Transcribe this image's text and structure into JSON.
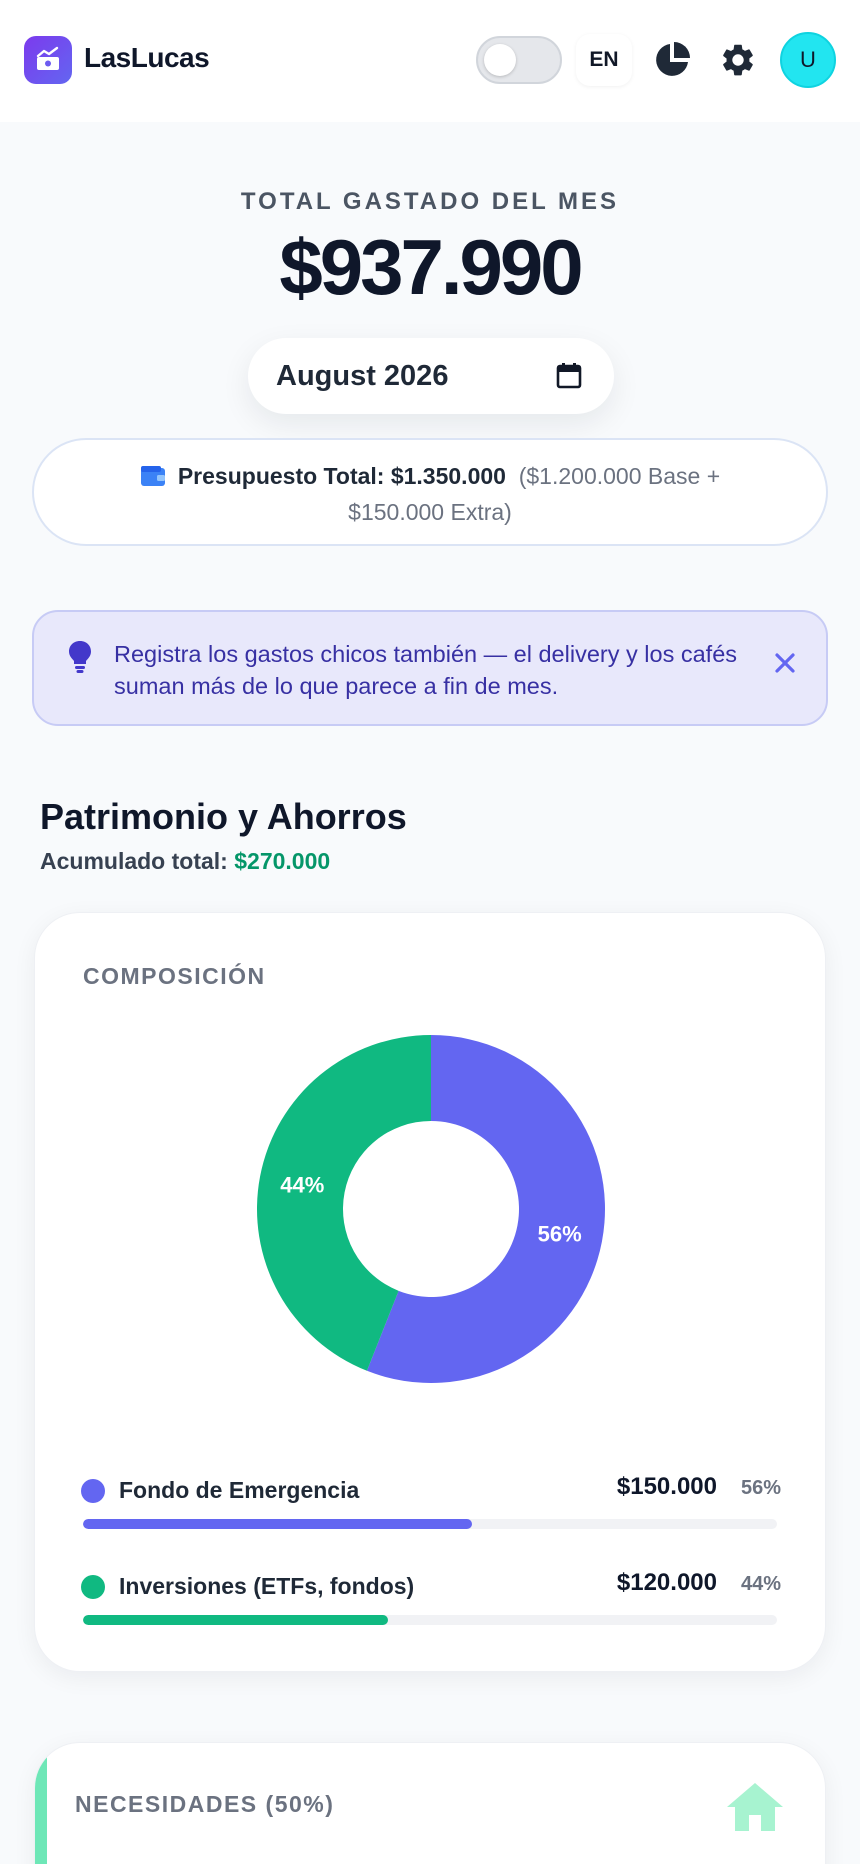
{
  "header": {
    "app_name": "LasLucas",
    "language": "EN",
    "avatar_initial": "U",
    "icons": [
      "logo-chart-icon",
      "pie-chart-icon",
      "gear-icon"
    ]
  },
  "summary": {
    "total_label": "TOTAL GASTADO DEL MES",
    "total_amount": "$937.990",
    "month": "August 2026"
  },
  "budget": {
    "label": "Presupuesto Total: $1.350.000",
    "detail": "($1.200.000 Base + $150.000 Extra)"
  },
  "tip": {
    "text": "Registra los gastos chicos también — el delivery y los cafés suman más de lo que parece a fin de mes."
  },
  "patrimonio": {
    "title": "Patrimonio y Ahorros",
    "subtitle_label": "Acumulado total:",
    "subtitle_amount": "$270.000",
    "card_label": "COMPOSICIÓN",
    "items": [
      {
        "name": "Fondo de Emergencia",
        "amount": "$150.000",
        "pct": "56%",
        "fraction": 0.56,
        "color": "#6366f1"
      },
      {
        "name": "Inversiones (ETFs, fondos)",
        "amount": "$120.000",
        "pct": "44%",
        "fraction": 0.44,
        "color": "#10b981"
      }
    ]
  },
  "needs": {
    "label": "NECESIDADES (50%)",
    "accent": "#6ee7b7"
  },
  "colors": {
    "accent": "#6366f1",
    "success": "#10b981",
    "tip_bg": "#e8e8fb",
    "tip_text": "#3730a3"
  }
}
